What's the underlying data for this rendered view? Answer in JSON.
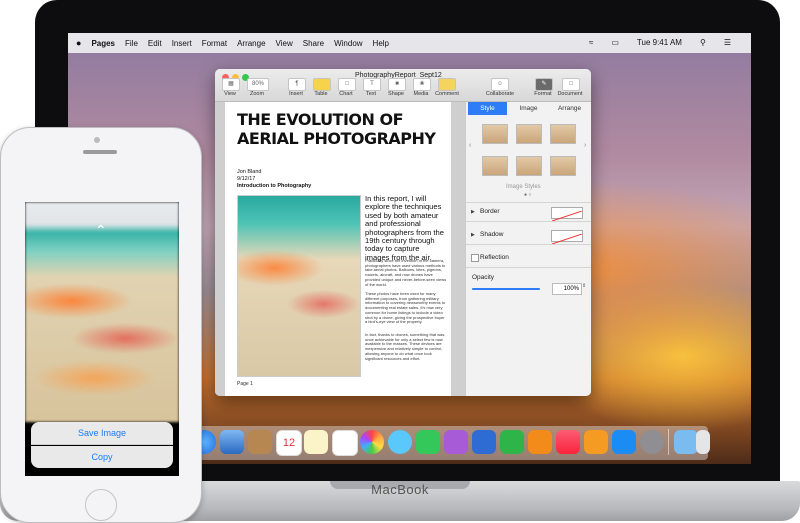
{
  "menubar": {
    "apple": "",
    "items": [
      "Pages",
      "File",
      "Edit",
      "Insert",
      "Format",
      "Arrange",
      "View",
      "Share",
      "Window",
      "Help"
    ],
    "time": "Tue 9:41 AM"
  },
  "window": {
    "title": "PhotographyReport_Sept12",
    "toolbar": {
      "view": "View",
      "zoom_value": "80%",
      "zoom": "Zoom",
      "insert": "Insert",
      "table": "Table",
      "chart": "Chart",
      "text": "Text",
      "shape": "Shape",
      "media": "Media",
      "comment": "Comment",
      "collaborate": "Collaborate",
      "format": "Format",
      "document": "Document"
    }
  },
  "document": {
    "headline_line1": "THE EVOLUTION OF",
    "headline_line2": "AERIAL PHOTOGRAPHY",
    "author": "Jon Bland",
    "date": "9/12/17",
    "subtitle": "Introduction to Photography",
    "intro": "In this report, I will explore the techniques used by both amateur and professional photographers from the 19th century through today to capture images from the air.",
    "para1": "Practically since the invention of the camera, photographers have used various methods to take aerial photos. Balloons, kites, pigeons, rockets, aircraft, and now drones have provided unique and never-before-seen views of the world.",
    "para2": "These photos have been used for many different purposes, from gathering military information to covering newsworthy events to documenting real estate sales. It's now very common for home listings to include a video shot by a drone, giving the prospective buyer a bird's-eye view of the property.",
    "para3": "In fact, thanks to drones, something that was once achievable for only a select few is now available to the masses. These devices are inexpensive and relatively simple to control, allowing anyone to do what once took significant resources and effort.",
    "page_label": "Page 1"
  },
  "sidebar": {
    "tabs": [
      "Style",
      "Image",
      "Arrange"
    ],
    "image_styles_label": "Image Styles",
    "border": "Border",
    "shadow": "Shadow",
    "reflection": "Reflection",
    "opacity": "Opacity",
    "opacity_value": "100%",
    "opacity_level": 1.0
  },
  "iphone": {
    "save_image": "Save Image",
    "copy": "Copy"
  },
  "macbook_label": "MacBook",
  "dock_icons": [
    "finder",
    "launchpad",
    "safari",
    "photos-preview",
    "contacts",
    "calendar",
    "notes",
    "reminders",
    "photos",
    "messages",
    "facetime",
    "itunes-store",
    "keynote",
    "numbers",
    "pages",
    "music",
    "ibooks",
    "app-store",
    "system-preferences",
    "downloads-folder",
    "trash"
  ]
}
